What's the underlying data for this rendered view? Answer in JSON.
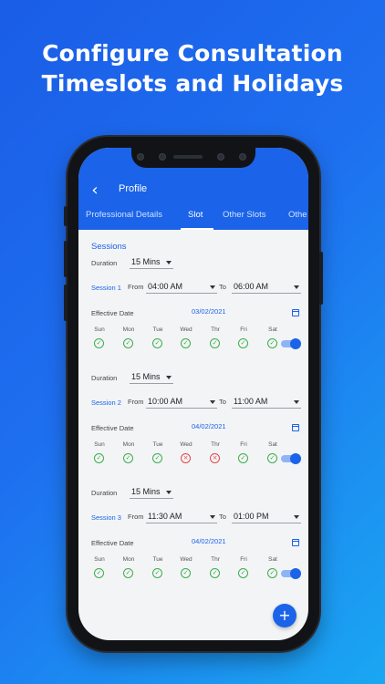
{
  "headline": {
    "line1": "Configure Consultation",
    "line2": "Timeslots and Holidays"
  },
  "appbar": {
    "back_icon": "back-arrow-icon",
    "title": "Profile"
  },
  "tabs": [
    {
      "label": "Professional Details",
      "active": false
    },
    {
      "label": "Slot",
      "active": true
    },
    {
      "label": "Other Slots",
      "active": false
    },
    {
      "label": "Othe",
      "active": false
    }
  ],
  "sessions": {
    "title": "Sessions",
    "duration_label": "Duration",
    "from_label": "From",
    "to_label": "To",
    "effective_label": "Effective Date",
    "items": [
      {
        "duration": "15 Mins",
        "name": "Session 1",
        "from": "04:00 AM",
        "to": "06:00 AM",
        "effective_date": "03/02/2021",
        "days": [
          {
            "name": "Sun",
            "enabled": true
          },
          {
            "name": "Mon",
            "enabled": true
          },
          {
            "name": "Tue",
            "enabled": true
          },
          {
            "name": "Wed",
            "enabled": true
          },
          {
            "name": "Thr",
            "enabled": true
          },
          {
            "name": "Fri",
            "enabled": true
          },
          {
            "name": "Sat",
            "enabled": true
          }
        ],
        "active": true
      },
      {
        "duration": "15 Mins",
        "name": "Session 2",
        "from": "10:00 AM",
        "to": "11:00 AM",
        "effective_date": "04/02/2021",
        "days": [
          {
            "name": "Sun",
            "enabled": true
          },
          {
            "name": "Mon",
            "enabled": true
          },
          {
            "name": "Tue",
            "enabled": true
          },
          {
            "name": "Wed",
            "enabled": false
          },
          {
            "name": "Thr",
            "enabled": false
          },
          {
            "name": "Fri",
            "enabled": true
          },
          {
            "name": "Sat",
            "enabled": true
          }
        ],
        "active": true
      },
      {
        "duration": "15 Mins",
        "name": "Session 3",
        "from": "11:30 AM",
        "to": "01:00 PM",
        "effective_date": "04/02/2021",
        "days": [
          {
            "name": "Sun",
            "enabled": true
          },
          {
            "name": "Mon",
            "enabled": true
          },
          {
            "name": "Tue",
            "enabled": true
          },
          {
            "name": "Wed",
            "enabled": true
          },
          {
            "name": "Thr",
            "enabled": true
          },
          {
            "name": "Fri",
            "enabled": true
          },
          {
            "name": "Sat",
            "enabled": true
          }
        ],
        "active": true
      }
    ]
  },
  "fab": {
    "label": "+",
    "icon": "plus-icon"
  },
  "colors": {
    "brand": "#1b63e8",
    "enabled": "#3cae4a",
    "disabled": "#e04848"
  }
}
